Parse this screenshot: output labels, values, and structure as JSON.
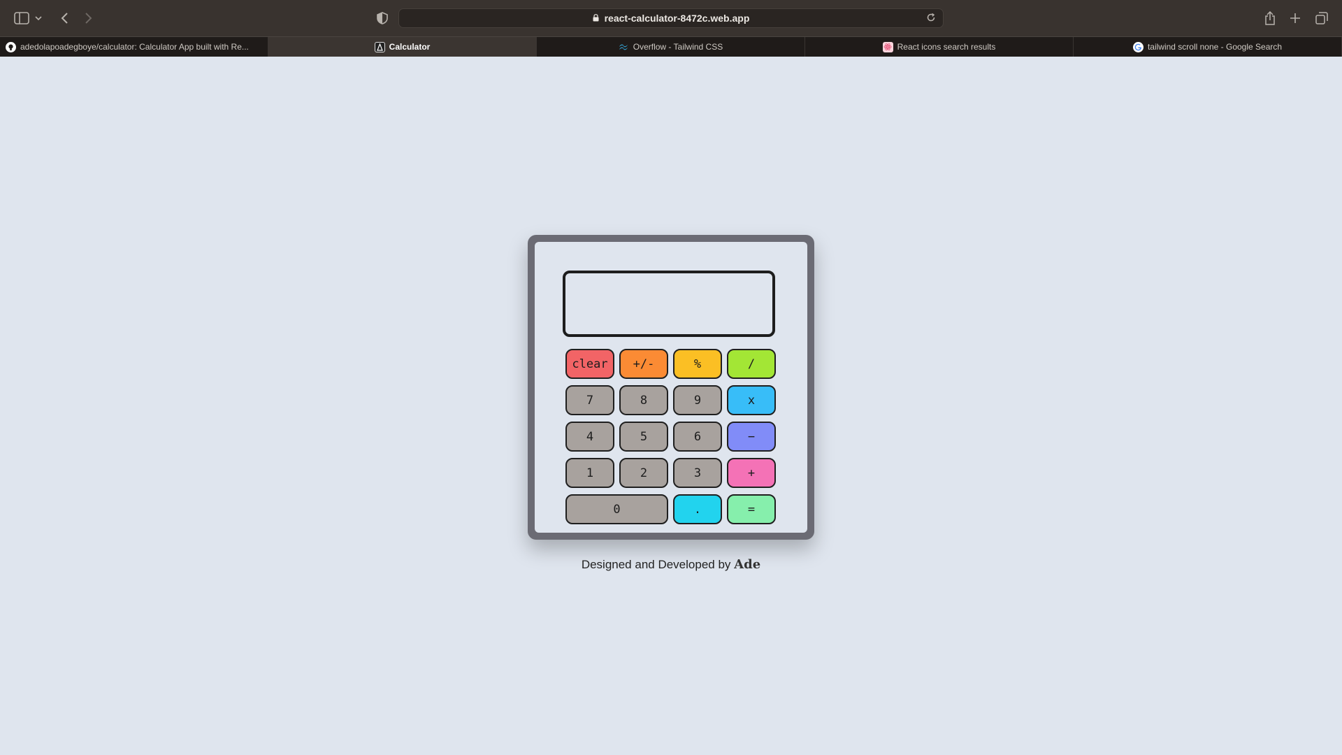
{
  "browser": {
    "url": "react-calculator-8472c.web.app",
    "tabs": [
      {
        "title": "adedolapoadegboye/calculator: Calculator App built with Re...",
        "icon": "github-icon",
        "color": "#ffffff"
      },
      {
        "title": "Calculator",
        "icon": "app-icon",
        "color": "#222222"
      },
      {
        "title": "Overflow - Tailwind CSS",
        "icon": "tailwind-icon",
        "color": "#38bdf8"
      },
      {
        "title": "React icons search results",
        "icon": "react-icons-icon",
        "color": "#e8577c"
      },
      {
        "title": "tailwind scroll none - Google Search",
        "icon": "google-icon",
        "color": "#ffffff"
      }
    ]
  },
  "calculator": {
    "display_value": "",
    "keys": [
      {
        "label": "clear",
        "color": "#f26466",
        "name": "clear-key"
      },
      {
        "label": "+/-",
        "color": "#fb8b34",
        "name": "sign-key"
      },
      {
        "label": "%",
        "color": "#fbbf24",
        "name": "percent-key"
      },
      {
        "label": "/",
        "color": "#a3e635",
        "name": "divide-key"
      },
      {
        "label": "7",
        "color": "#a8a29e",
        "name": "digit-7-key"
      },
      {
        "label": "8",
        "color": "#a8a29e",
        "name": "digit-8-key"
      },
      {
        "label": "9",
        "color": "#a8a29e",
        "name": "digit-9-key"
      },
      {
        "label": "x",
        "color": "#38bdf8",
        "name": "multiply-key"
      },
      {
        "label": "4",
        "color": "#a8a29e",
        "name": "digit-4-key"
      },
      {
        "label": "5",
        "color": "#a8a29e",
        "name": "digit-5-key"
      },
      {
        "label": "6",
        "color": "#a8a29e",
        "name": "digit-6-key"
      },
      {
        "label": "−",
        "color": "#818cf8",
        "name": "subtract-key"
      },
      {
        "label": "1",
        "color": "#a8a29e",
        "name": "digit-1-key"
      },
      {
        "label": "2",
        "color": "#a8a29e",
        "name": "digit-2-key"
      },
      {
        "label": "3",
        "color": "#a8a29e",
        "name": "digit-3-key"
      },
      {
        "label": "+",
        "color": "#f472b6",
        "name": "add-key"
      },
      {
        "label": "0",
        "color": "#a8a29e",
        "name": "digit-0-key",
        "wide": true
      },
      {
        "label": ".",
        "color": "#22d3ee",
        "name": "decimal-key"
      },
      {
        "label": "=",
        "color": "#86efac",
        "name": "equals-key"
      }
    ]
  },
  "footer": {
    "text": "Designed and Developed by",
    "author": "Ade"
  }
}
